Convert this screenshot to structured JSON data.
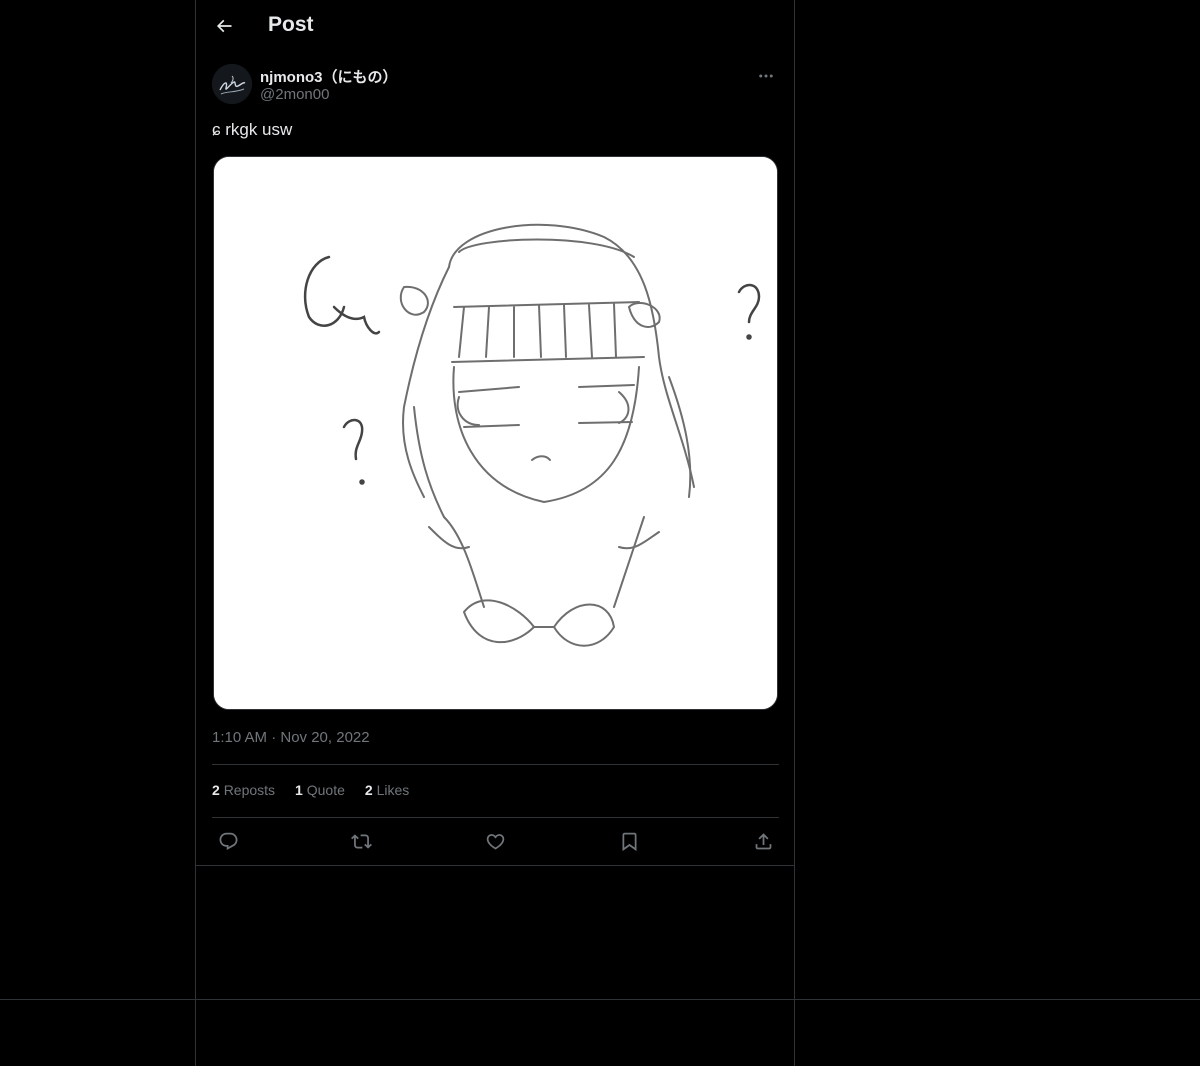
{
  "header": {
    "title": "Post"
  },
  "post": {
    "author": {
      "display_name": "njmono3（にもの）",
      "handle": "@2mon00"
    },
    "text": "ɕ rkgk usw",
    "timestamp": "1:10 AM · Nov 20, 2022",
    "stats": [
      {
        "count": "2",
        "label": "Reposts"
      },
      {
        "count": "1",
        "label": "Quote"
      },
      {
        "count": "2",
        "label": "Likes"
      }
    ],
    "actions": [
      "reply-icon",
      "repost-icon",
      "like-icon",
      "bookmark-icon",
      "share-icon"
    ]
  },
  "colors": {
    "background": "#000000",
    "border": "#2f3336",
    "text_primary": "#e7e9ea",
    "text_secondary": "#71767b"
  }
}
